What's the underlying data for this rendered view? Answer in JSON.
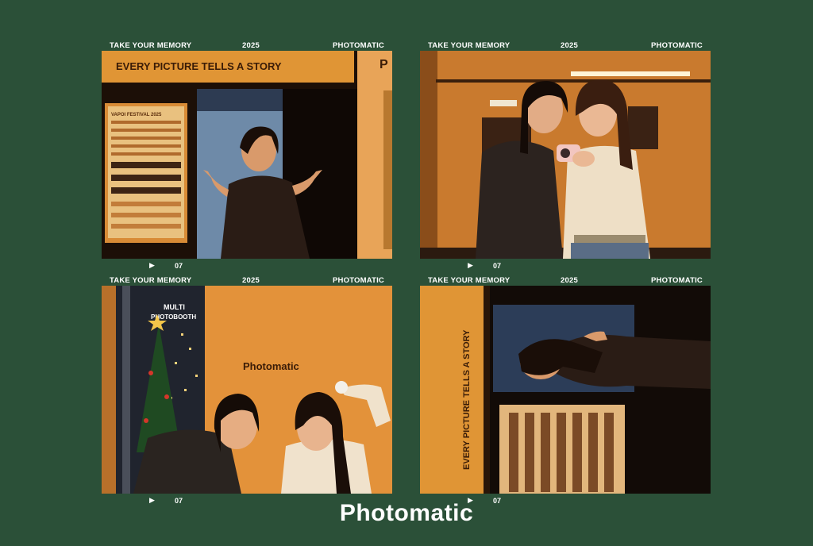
{
  "frames": [
    {
      "header": {
        "left": "TAKE YOUR MEMORY",
        "center": "2025",
        "right": "PHOTOMATIC"
      },
      "footer": {
        "play_icon": "play-triangle-icon",
        "number": "07"
      },
      "scene": {
        "banner": "EVERY PICTURE TELLS A STORY",
        "poster": "VAPOI FESTIVAL 2025",
        "corner": "P"
      }
    },
    {
      "header": {
        "left": "TAKE YOUR MEMORY",
        "center": "2025",
        "right": "PHOTOMATIC"
      },
      "footer": {
        "play_icon": "play-triangle-icon",
        "number": "07"
      },
      "scene": {}
    },
    {
      "header": {
        "left": "TAKE YOUR MEMORY",
        "center": "2025",
        "right": "PHOTOMATIC"
      },
      "footer": {
        "play_icon": "play-triangle-icon",
        "number": "07"
      },
      "scene": {
        "wall_text": "Photomatic",
        "sign_line1": "MULTI",
        "sign_line2": "PHOTOBOOTH"
      }
    },
    {
      "header": {
        "left": "TAKE YOUR MEMORY",
        "center": "2025",
        "right": "PHOTOMATIC"
      },
      "footer": {
        "play_icon": "play-triangle-icon",
        "number": "07"
      },
      "scene": {
        "banner": "EVERY PICTURE TELLS A STORY"
      }
    }
  ],
  "brand": "Photomatic",
  "colors": {
    "background": "#2b5038",
    "text": "#ffffff",
    "warm_wall": "#d9892f"
  }
}
